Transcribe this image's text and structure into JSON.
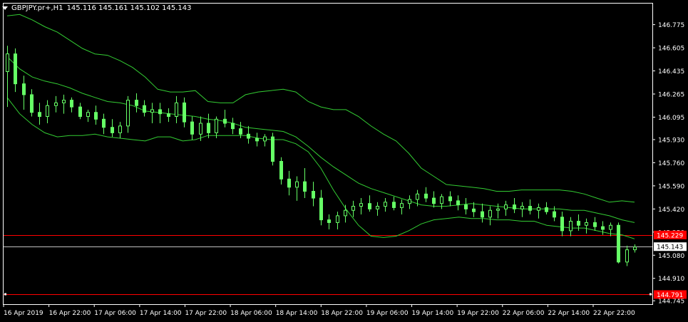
{
  "header": {
    "symbol": "GBPJPY.pr+,H1",
    "ohlc": "145.116 145.161 145.102 145.143",
    "menu_icon": "triangle-down-icon"
  },
  "colors": {
    "background": "#000000",
    "frame": "#ffffff",
    "candle": "#66ff66",
    "bands": "#33cc33",
    "hline": "#ff0000",
    "bid_line": "#c0c0c0",
    "label_bg_red": "#ff0000",
    "label_bg_white": "#ffffff"
  },
  "chart_data": {
    "type": "candlestick",
    "symbol": "GBPJPY.pr+",
    "timeframe": "H1",
    "y_ticks": [
      "146.775",
      "146.605",
      "146.435",
      "146.265",
      "146.095",
      "145.930",
      "145.760",
      "145.590",
      "145.420",
      "145.250",
      "145.080",
      "144.910",
      "144.745"
    ],
    "x_ticks": [
      "16 Apr 2019",
      "16 Apr 22:00",
      "17 Apr 06:00",
      "17 Apr 14:00",
      "17 Apr 22:00",
      "18 Apr 06:00",
      "18 Apr 14:00",
      "18 Apr 22:00",
      "19 Apr 06:00",
      "19 Apr 14:00",
      "19 Apr 22:00",
      "22 Apr 06:00",
      "22 Apr 14:00",
      "22 Apr 22:00"
    ],
    "ylim": [
      144.72,
      146.93
    ],
    "current_price": "145.143",
    "horizontal_lines": [
      {
        "label": "145.229",
        "value": 145.229
      },
      {
        "label": "144.791",
        "value": 144.791
      }
    ],
    "indicator": "Bollinger Bands",
    "upper_band": [
      146.84,
      146.85,
      146.81,
      146.76,
      146.72,
      146.66,
      146.6,
      146.56,
      146.55,
      146.51,
      146.46,
      146.39,
      146.3,
      146.28,
      146.28,
      146.29,
      146.21,
      146.2,
      146.2,
      146.26,
      146.28,
      146.29,
      146.3,
      146.28,
      146.21,
      146.17,
      146.15,
      146.15,
      146.1,
      146.03,
      145.97,
      145.92,
      145.83,
      145.72,
      145.66,
      145.6,
      145.59,
      145.58,
      145.57,
      145.55,
      145.55,
      145.56,
      145.56,
      145.56,
      145.56,
      145.55,
      145.53,
      145.5,
      145.47,
      145.48,
      145.47
    ],
    "middle_band": [
      146.54,
      146.45,
      146.39,
      146.36,
      146.34,
      146.31,
      146.27,
      146.24,
      146.21,
      146.2,
      146.18,
      146.14,
      146.13,
      146.12,
      146.11,
      146.1,
      146.08,
      146.07,
      146.05,
      146.02,
      146.01,
      146.0,
      145.99,
      145.95,
      145.88,
      145.8,
      145.73,
      145.67,
      145.61,
      145.57,
      145.54,
      145.51,
      145.48,
      145.45,
      145.44,
      145.44,
      145.45,
      145.46,
      145.45,
      145.44,
      145.43,
      145.42,
      145.42,
      145.42,
      145.42,
      145.41,
      145.41,
      145.39,
      145.37,
      145.34,
      145.32
    ],
    "lower_band": [
      146.24,
      146.12,
      146.04,
      145.98,
      145.95,
      145.96,
      145.96,
      145.97,
      145.95,
      145.94,
      145.93,
      145.92,
      145.95,
      145.95,
      145.92,
      145.93,
      145.96,
      145.96,
      145.96,
      145.96,
      145.94,
      145.93,
      145.93,
      145.9,
      145.84,
      145.72,
      145.56,
      145.42,
      145.3,
      145.22,
      145.21,
      145.22,
      145.26,
      145.31,
      145.34,
      145.35,
      145.36,
      145.35,
      145.35,
      145.34,
      145.34,
      145.33,
      145.33,
      145.3,
      145.29,
      145.28,
      145.28,
      145.26,
      145.24,
      145.23,
      145.2
    ],
    "candles": [
      {
        "o": 146.43,
        "h": 146.62,
        "l": 146.17,
        "c": 146.56
      },
      {
        "o": 146.56,
        "h": 146.6,
        "l": 146.28,
        "c": 146.34
      },
      {
        "o": 146.34,
        "h": 146.4,
        "l": 146.15,
        "c": 146.26
      },
      {
        "o": 146.26,
        "h": 146.3,
        "l": 146.1,
        "c": 146.13
      },
      {
        "o": 146.13,
        "h": 146.2,
        "l": 146.04,
        "c": 146.1
      },
      {
        "o": 146.1,
        "h": 146.22,
        "l": 146.05,
        "c": 146.18
      },
      {
        "o": 146.18,
        "h": 146.25,
        "l": 146.13,
        "c": 146.2
      },
      {
        "o": 146.2,
        "h": 146.26,
        "l": 146.12,
        "c": 146.22
      },
      {
        "o": 146.22,
        "h": 146.24,
        "l": 146.13,
        "c": 146.17
      },
      {
        "o": 146.17,
        "h": 146.2,
        "l": 146.08,
        "c": 146.1
      },
      {
        "o": 146.1,
        "h": 146.15,
        "l": 146.06,
        "c": 146.13
      },
      {
        "o": 146.13,
        "h": 146.18,
        "l": 146.04,
        "c": 146.08
      },
      {
        "o": 146.08,
        "h": 146.12,
        "l": 145.97,
        "c": 146.02
      },
      {
        "o": 146.02,
        "h": 146.08,
        "l": 145.95,
        "c": 145.98
      },
      {
        "o": 145.98,
        "h": 146.06,
        "l": 145.94,
        "c": 146.03
      },
      {
        "o": 146.03,
        "h": 146.25,
        "l": 145.98,
        "c": 146.22
      },
      {
        "o": 146.22,
        "h": 146.27,
        "l": 146.13,
        "c": 146.18
      },
      {
        "o": 146.18,
        "h": 146.22,
        "l": 146.1,
        "c": 146.13
      },
      {
        "o": 146.13,
        "h": 146.2,
        "l": 146.05,
        "c": 146.15
      },
      {
        "o": 146.15,
        "h": 146.2,
        "l": 146.05,
        "c": 146.12
      },
      {
        "o": 146.12,
        "h": 146.16,
        "l": 146.06,
        "c": 146.1
      },
      {
        "o": 146.1,
        "h": 146.25,
        "l": 146.05,
        "c": 146.2
      },
      {
        "o": 146.2,
        "h": 146.24,
        "l": 146.02,
        "c": 146.06
      },
      {
        "o": 146.06,
        "h": 146.1,
        "l": 145.93,
        "c": 145.97
      },
      {
        "o": 145.97,
        "h": 146.1,
        "l": 145.92,
        "c": 146.05
      },
      {
        "o": 146.05,
        "h": 146.12,
        "l": 145.94,
        "c": 145.98
      },
      {
        "o": 145.98,
        "h": 146.1,
        "l": 145.94,
        "c": 146.08
      },
      {
        "o": 146.08,
        "h": 146.15,
        "l": 146.02,
        "c": 146.05
      },
      {
        "o": 146.05,
        "h": 146.09,
        "l": 145.97,
        "c": 146.01
      },
      {
        "o": 146.01,
        "h": 146.06,
        "l": 145.94,
        "c": 145.97
      },
      {
        "o": 145.97,
        "h": 146.03,
        "l": 145.9,
        "c": 145.94
      },
      {
        "o": 145.94,
        "h": 145.98,
        "l": 145.88,
        "c": 145.92
      },
      {
        "o": 145.92,
        "h": 145.97,
        "l": 145.88,
        "c": 145.95
      },
      {
        "o": 145.95,
        "h": 145.98,
        "l": 145.74,
        "c": 145.77
      },
      {
        "o": 145.77,
        "h": 145.8,
        "l": 145.6,
        "c": 145.64
      },
      {
        "o": 145.64,
        "h": 145.7,
        "l": 145.52,
        "c": 145.58
      },
      {
        "o": 145.58,
        "h": 145.66,
        "l": 145.48,
        "c": 145.62
      },
      {
        "o": 145.62,
        "h": 145.72,
        "l": 145.5,
        "c": 145.55
      },
      {
        "o": 145.55,
        "h": 145.62,
        "l": 145.44,
        "c": 145.5
      },
      {
        "o": 145.5,
        "h": 145.56,
        "l": 145.3,
        "c": 145.34
      },
      {
        "o": 145.34,
        "h": 145.38,
        "l": 145.27,
        "c": 145.32
      },
      {
        "o": 145.32,
        "h": 145.4,
        "l": 145.27,
        "c": 145.37
      },
      {
        "o": 145.37,
        "h": 145.45,
        "l": 145.32,
        "c": 145.41
      },
      {
        "o": 145.41,
        "h": 145.48,
        "l": 145.36,
        "c": 145.44
      },
      {
        "o": 145.44,
        "h": 145.5,
        "l": 145.38,
        "c": 145.46
      },
      {
        "o": 145.46,
        "h": 145.52,
        "l": 145.4,
        "c": 145.42
      },
      {
        "o": 145.42,
        "h": 145.47,
        "l": 145.37,
        "c": 145.44
      },
      {
        "o": 145.44,
        "h": 145.5,
        "l": 145.4,
        "c": 145.47
      },
      {
        "o": 145.47,
        "h": 145.51,
        "l": 145.41,
        "c": 145.43
      },
      {
        "o": 145.43,
        "h": 145.49,
        "l": 145.38,
        "c": 145.46
      },
      {
        "o": 145.46,
        "h": 145.52,
        "l": 145.42,
        "c": 145.49
      },
      {
        "o": 145.49,
        "h": 145.56,
        "l": 145.44,
        "c": 145.53
      },
      {
        "o": 145.53,
        "h": 145.58,
        "l": 145.47,
        "c": 145.5
      },
      {
        "o": 145.5,
        "h": 145.55,
        "l": 145.43,
        "c": 145.46
      },
      {
        "o": 145.46,
        "h": 145.53,
        "l": 145.42,
        "c": 145.51
      },
      {
        "o": 145.51,
        "h": 145.55,
        "l": 145.44,
        "c": 145.48
      },
      {
        "o": 145.48,
        "h": 145.52,
        "l": 145.41,
        "c": 145.45
      },
      {
        "o": 145.45,
        "h": 145.5,
        "l": 145.38,
        "c": 145.42
      },
      {
        "o": 145.42,
        "h": 145.47,
        "l": 145.36,
        "c": 145.4
      },
      {
        "o": 145.4,
        "h": 145.46,
        "l": 145.32,
        "c": 145.36
      },
      {
        "o": 145.36,
        "h": 145.44,
        "l": 145.3,
        "c": 145.41
      },
      {
        "o": 145.41,
        "h": 145.46,
        "l": 145.35,
        "c": 145.42
      },
      {
        "o": 145.42,
        "h": 145.48,
        "l": 145.37,
        "c": 145.45
      },
      {
        "o": 145.45,
        "h": 145.5,
        "l": 145.39,
        "c": 145.42
      },
      {
        "o": 145.42,
        "h": 145.47,
        "l": 145.36,
        "c": 145.44
      },
      {
        "o": 145.44,
        "h": 145.49,
        "l": 145.38,
        "c": 145.41
      },
      {
        "o": 145.41,
        "h": 145.46,
        "l": 145.35,
        "c": 145.43
      },
      {
        "o": 145.43,
        "h": 145.47,
        "l": 145.38,
        "c": 145.4
      },
      {
        "o": 145.4,
        "h": 145.44,
        "l": 145.33,
        "c": 145.36
      },
      {
        "o": 145.36,
        "h": 145.4,
        "l": 145.22,
        "c": 145.26
      },
      {
        "o": 145.26,
        "h": 145.36,
        "l": 145.22,
        "c": 145.33
      },
      {
        "o": 145.33,
        "h": 145.38,
        "l": 145.26,
        "c": 145.3
      },
      {
        "o": 145.3,
        "h": 145.35,
        "l": 145.24,
        "c": 145.32
      },
      {
        "o": 145.32,
        "h": 145.36,
        "l": 145.26,
        "c": 145.29
      },
      {
        "o": 145.29,
        "h": 145.33,
        "l": 145.23,
        "c": 145.27
      },
      {
        "o": 145.27,
        "h": 145.32,
        "l": 145.22,
        "c": 145.3
      },
      {
        "o": 145.3,
        "h": 145.32,
        "l": 145.02,
        "c": 145.03
      },
      {
        "o": 145.03,
        "h": 145.15,
        "l": 145.0,
        "c": 145.12
      },
      {
        "o": 145.12,
        "h": 145.16,
        "l": 145.1,
        "c": 145.14
      }
    ]
  },
  "price_axis": {
    "current_label": "145.143",
    "hline_labels": [
      "145.229",
      "144.791"
    ]
  }
}
